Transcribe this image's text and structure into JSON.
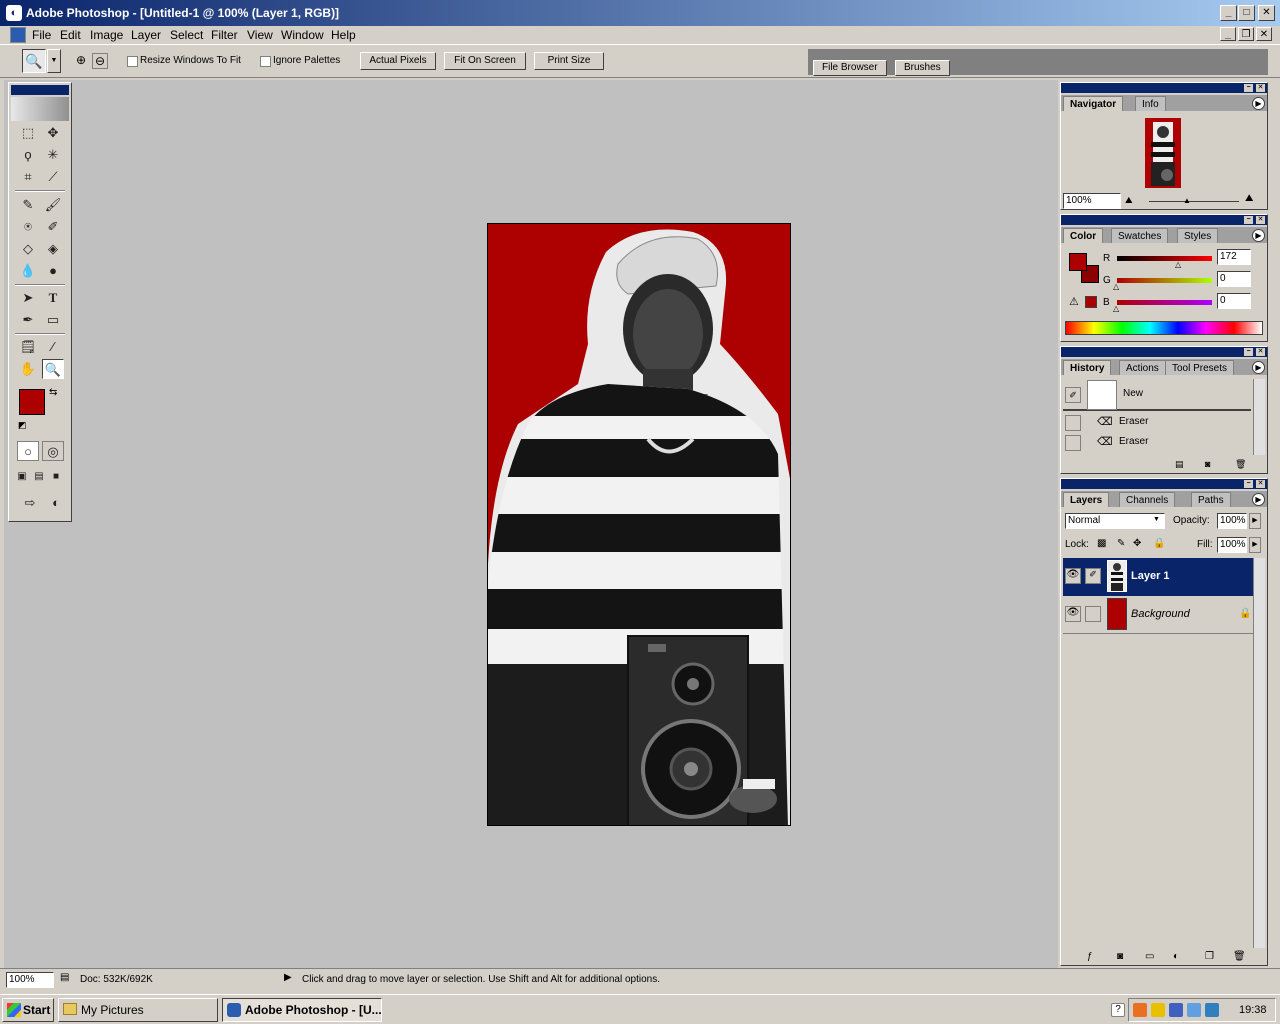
{
  "window": {
    "title": "Adobe Photoshop - [Untitled-1 @ 100% (Layer 1, RGB)]"
  },
  "menu": [
    "File",
    "Edit",
    "Image",
    "Layer",
    "Select",
    "Filter",
    "View",
    "Window",
    "Help"
  ],
  "options": {
    "resize_windows": "Resize Windows To Fit",
    "ignore_palettes": "Ignore Palettes",
    "actual_pixels": "Actual Pixels",
    "fit_on_screen": "Fit On Screen",
    "print_size": "Print Size",
    "well_tabs": [
      "File Browser",
      "Brushes"
    ]
  },
  "colors": {
    "foreground": "#ad0000",
    "background": "#8b0000"
  },
  "navigator": {
    "tabs": [
      "Navigator",
      "Info"
    ],
    "zoom": "100%"
  },
  "color_palette": {
    "tabs": [
      "Color",
      "Swatches",
      "Styles"
    ],
    "r_label": "R",
    "g_label": "G",
    "b_label": "B",
    "r": "172",
    "g": "0",
    "b": "0"
  },
  "history": {
    "tabs": [
      "History",
      "Actions",
      "Tool Presets"
    ],
    "items": [
      "New",
      "Eraser",
      "Eraser"
    ]
  },
  "layers": {
    "tabs": [
      "Layers",
      "Channels",
      "Paths"
    ],
    "blend_mode": "Normal",
    "opacity_label": "Opacity:",
    "opacity": "100%",
    "lock_label": "Lock:",
    "fill_label": "Fill:",
    "fill": "100%",
    "items": [
      "Layer 1",
      "Background"
    ]
  },
  "status": {
    "zoom": "100%",
    "doc": "Doc: 532K/692K",
    "hint": "Click and drag to move layer or selection.  Use Shift and Alt for additional options."
  },
  "taskbar": {
    "start": "Start",
    "tasks": [
      "My Pictures",
      "Adobe Photoshop - [U..."
    ],
    "clock": "19:38"
  }
}
